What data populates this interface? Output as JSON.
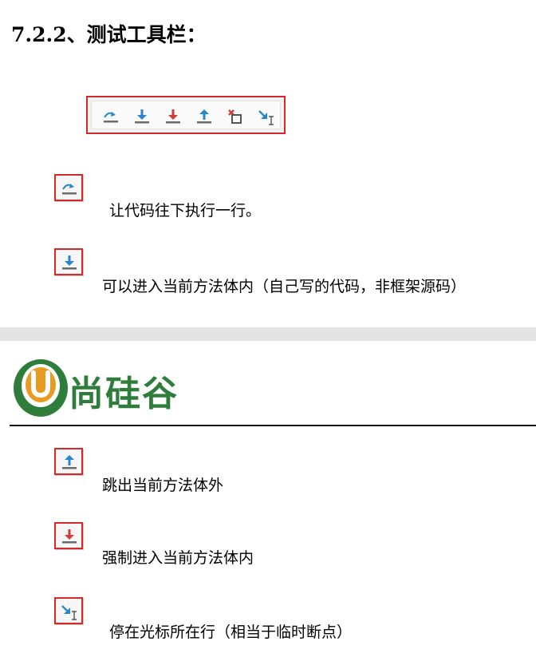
{
  "heading": "7.2.2、测试工具栏：",
  "toolbar": {
    "icons": [
      "step-over-icon",
      "step-into-icon",
      "force-step-into-icon",
      "step-out-icon",
      "drop-frame-icon",
      "run-to-cursor-icon"
    ]
  },
  "items": [
    {
      "icon": "step-over-icon",
      "text": "让代码往下执行一行。"
    },
    {
      "icon": "step-into-icon",
      "text": "可以进入当前方法体内（自己写的代码，非框架源码）"
    },
    {
      "icon": "step-out-icon",
      "text": "跳出当前方法体外"
    },
    {
      "icon": "force-step-into-icon",
      "text": "强制进入当前方法体内"
    },
    {
      "icon": "run-to-cursor-icon",
      "text": "停在光标所在行（相当于临时断点）"
    }
  ],
  "logo": {
    "mark": "U",
    "name": "尚硅谷",
    "colors": {
      "green": "#2f7d3b",
      "orange": "#e99a22"
    }
  },
  "colors": {
    "frame_red": "#d62a2a",
    "icon_blue": "#2a86c9",
    "icon_red": "#d23b3b",
    "icon_gray": "#6b6b6b"
  }
}
